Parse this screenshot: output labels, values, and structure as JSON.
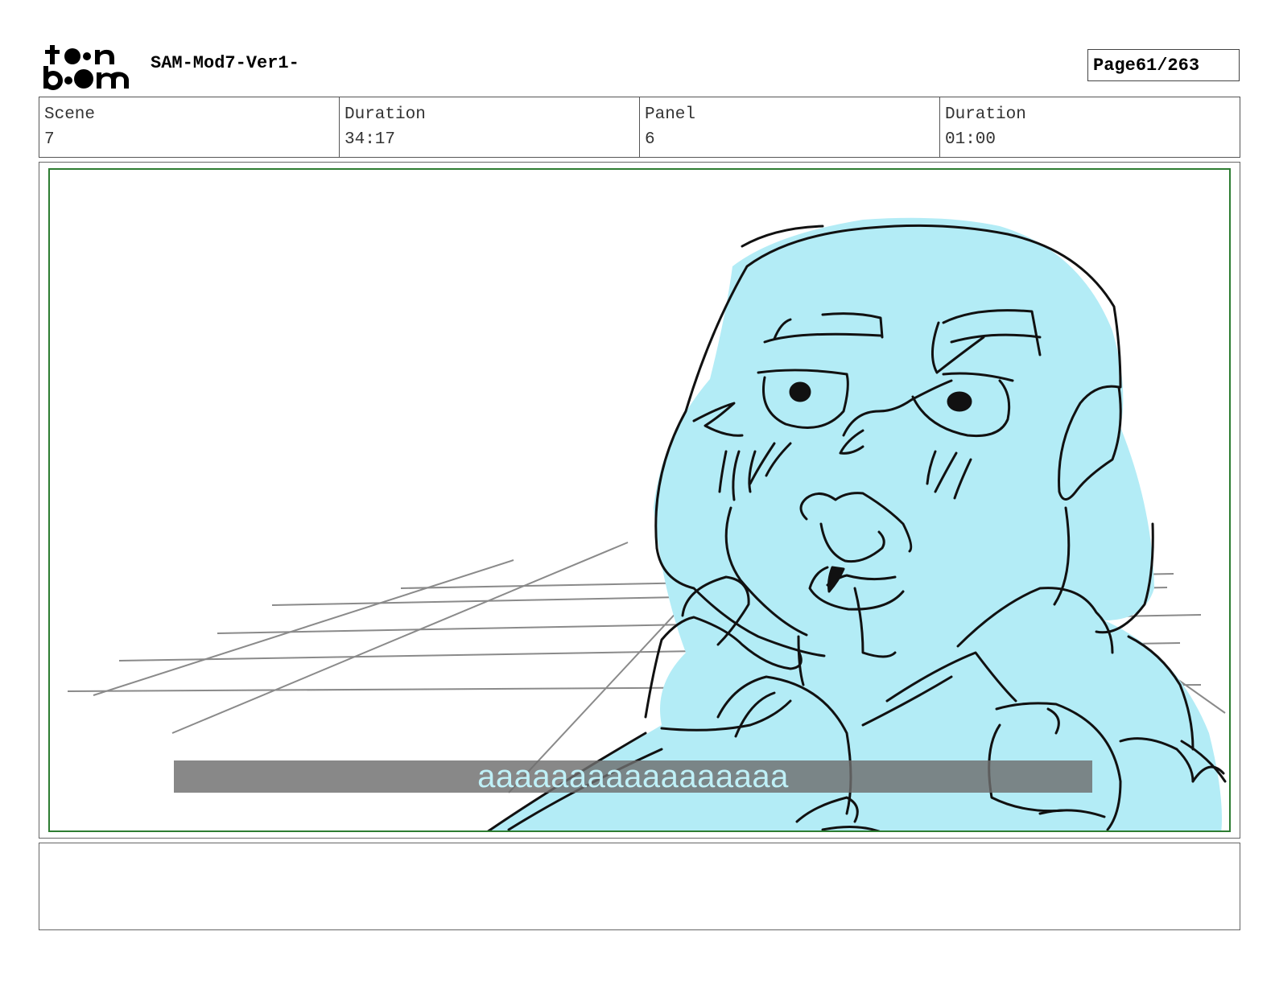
{
  "header": {
    "logo_text": "toon boom",
    "project_title": "SAM-Mod7-Ver1-",
    "page_label": "Page",
    "page_number": "61/263"
  },
  "info": {
    "scene_label": "Scene",
    "scene_value": "7",
    "scene_duration_label": "Duration",
    "scene_duration_value": "34:17",
    "panel_label": "Panel",
    "panel_value": "6",
    "panel_duration_label": "Duration",
    "panel_duration_value": "01:00"
  },
  "panel": {
    "subtitle": "aaaaaaaaaaaaaaaaa",
    "frame_color": "#2e7d32",
    "character_fill": "#b3ecf6"
  },
  "notes": {
    "text": ""
  }
}
